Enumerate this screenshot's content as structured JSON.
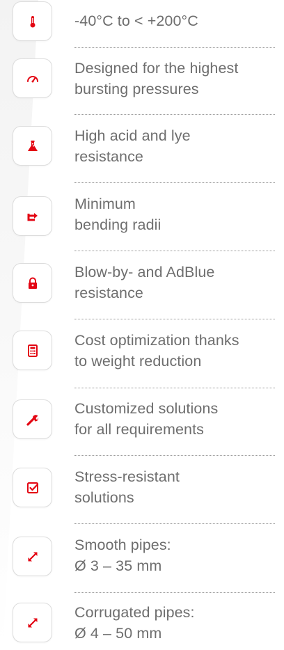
{
  "accent_color": "#e30613",
  "features": [
    {
      "icon": "thermometer-icon",
      "lines": [
        "-40°C to < +200°C"
      ]
    },
    {
      "icon": "gauge-icon",
      "lines": [
        "Designed for the highest",
        "bursting pressures"
      ]
    },
    {
      "icon": "flask-icon",
      "lines": [
        "High acid and lye",
        "resistance"
      ]
    },
    {
      "icon": "bend-arrow-icon",
      "lines": [
        "Minimum",
        "bending radii"
      ]
    },
    {
      "icon": "padlock-icon",
      "lines": [
        "Blow-by- and AdBlue",
        "resistance"
      ]
    },
    {
      "icon": "calculator-icon",
      "lines": [
        "Cost optimization thanks",
        "to weight reduction"
      ]
    },
    {
      "icon": "wrench-icon",
      "lines": [
        "Customized solutions",
        "for all requirements"
      ]
    },
    {
      "icon": "checkbox-icon",
      "lines": [
        "Stress-resistant",
        "solutions"
      ]
    },
    {
      "icon": "diagonal-arrows-icon",
      "lines": [
        "Smooth pipes:",
        "Ø 3 – 35 mm"
      ]
    },
    {
      "icon": "diagonal-arrows-icon",
      "lines": [
        "Corrugated pipes:",
        "Ø 4 – 50 mm"
      ]
    }
  ]
}
